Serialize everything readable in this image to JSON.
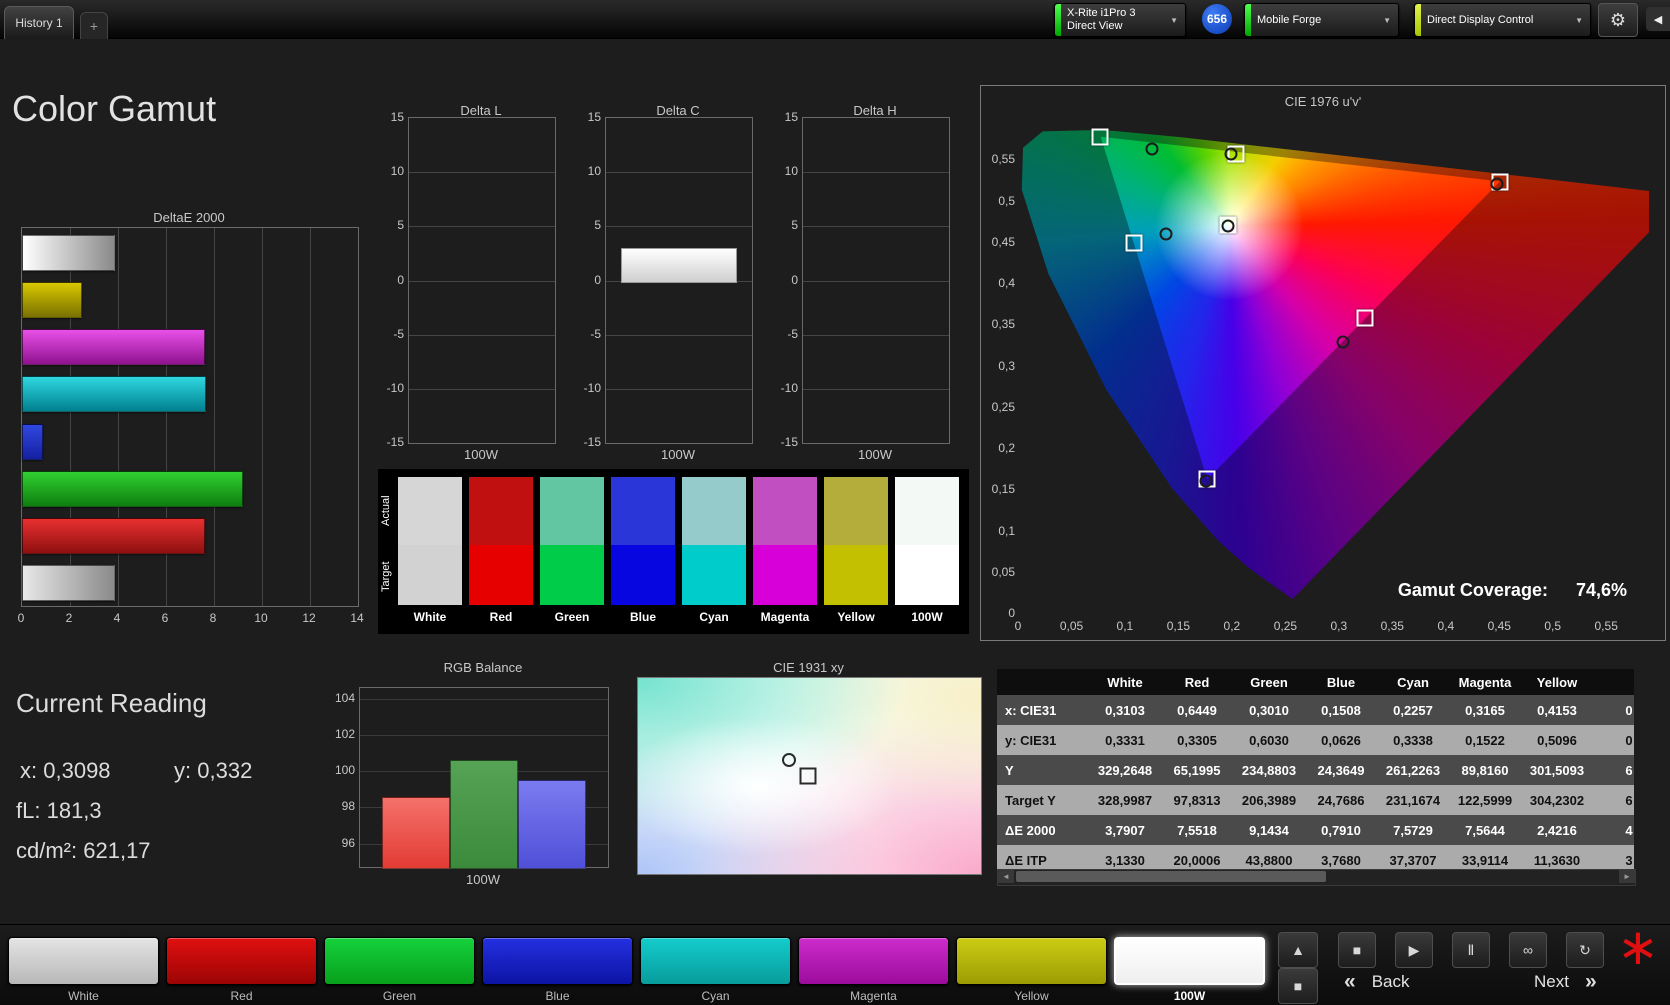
{
  "top_bar": {
    "history_tab": "History 1",
    "add_tab": "+",
    "meter_line1": "X-Rite i1Pro 3",
    "meter_line2": "Direct View",
    "reading_badge": "656",
    "pattern_source": "Mobile Forge",
    "display_control": "Direct Display Control"
  },
  "page_title": "Color Gamut",
  "icons": {
    "chevron_down": "▼",
    "gear": "⚙",
    "collapse_left": "◀",
    "up": "▲",
    "frame": "■",
    "asterisk": "∗",
    "back_chevrons": "«",
    "next_chevrons": "»",
    "scroll_left": "◄",
    "scroll_right": "►"
  },
  "deltae2000": {
    "type": "bar",
    "title": "DeltaE 2000",
    "xlim": [
      0,
      14
    ],
    "xticks": [
      0,
      2,
      4,
      6,
      8,
      10,
      12,
      14
    ],
    "series": [
      {
        "name": "White",
        "value": 3.79,
        "color1": "#ffffff",
        "color2": "#8a8a8a"
      },
      {
        "name": "Yellow",
        "value": 2.42,
        "color1": "#d8c800",
        "color2": "#7a7000"
      },
      {
        "name": "Magenta",
        "value": 7.56,
        "color1": "#e850e8",
        "color2": "#90128f"
      },
      {
        "name": "Cyan",
        "value": 7.57,
        "color1": "#2fd8e0",
        "color2": "#00808f"
      },
      {
        "name": "Blue",
        "value": 0.79,
        "color1": "#3048e0",
        "color2": "#1520a0"
      },
      {
        "name": "Green",
        "value": 9.14,
        "color1": "#30d030",
        "color2": "#0f7f10"
      },
      {
        "name": "Red",
        "value": 7.55,
        "color1": "#e83030",
        "color2": "#8f1010"
      },
      {
        "name": "100W",
        "value": 3.79,
        "color1": "#e8e8e8",
        "color2": "#8a8a8a"
      }
    ]
  },
  "delta_l": {
    "type": "bar",
    "title": "Delta L",
    "ylim": [
      -15,
      15
    ],
    "yticks": [
      15,
      10,
      5,
      0,
      -5,
      -10,
      -15
    ],
    "category": "100W",
    "value": 0
  },
  "delta_c": {
    "type": "bar",
    "title": "Delta C",
    "ylim": [
      -15,
      15
    ],
    "yticks": [
      15,
      10,
      5,
      0,
      -5,
      -10,
      -15
    ],
    "category": "100W",
    "value": 3
  },
  "delta_h": {
    "type": "bar",
    "title": "Delta H",
    "ylim": [
      -15,
      15
    ],
    "yticks": [
      15,
      10,
      5,
      0,
      -5,
      -10,
      -15
    ],
    "category": "100W",
    "value": 0
  },
  "swatches": {
    "row_labels": [
      "Actual",
      "Target"
    ],
    "columns": [
      {
        "label": "White",
        "actual": "#d6d6d6",
        "target": "#d2d2d2"
      },
      {
        "label": "Red",
        "actual": "#c01010",
        "target": "#e60000"
      },
      {
        "label": "Green",
        "actual": "#63c6a2",
        "target": "#00cc4a"
      },
      {
        "label": "Blue",
        "actual": "#2b36d8",
        "target": "#0806e0"
      },
      {
        "label": "Cyan",
        "actual": "#96cbcb",
        "target": "#00cccc"
      },
      {
        "label": "Magenta",
        "actual": "#c24fc2",
        "target": "#d800d8"
      },
      {
        "label": "Yellow",
        "actual": "#b4ad3c",
        "target": "#c2c000"
      },
      {
        "label": "100W",
        "actual": "#f3faf5",
        "target": "#ffffff"
      }
    ]
  },
  "cie1976": {
    "title": "CIE 1976 u'v'",
    "gamut_coverage_label": "Gamut Coverage:",
    "gamut_coverage_value": "74,6%",
    "x_ticks": [
      "0",
      "0,05",
      "0,1",
      "0,15",
      "0,2",
      "0,25",
      "0,3",
      "0,35",
      "0,4",
      "0,45",
      "0,5",
      "0,55"
    ],
    "y_ticks": [
      "0,55",
      "0,5",
      "0,45",
      "0,4",
      "0,35",
      "0,3",
      "0,25",
      "0,2",
      "0,15",
      "0,1",
      "0,05",
      "0"
    ],
    "targets": [
      {
        "name": "green",
        "u": 0.077,
        "v": 0.577
      },
      {
        "name": "yellow",
        "u": 0.204,
        "v": 0.557
      },
      {
        "name": "red",
        "u": 0.451,
        "v": 0.523
      },
      {
        "name": "cyan",
        "u": 0.108,
        "v": 0.448
      },
      {
        "name": "white",
        "u": 0.196,
        "v": 0.47
      },
      {
        "name": "magenta",
        "u": 0.324,
        "v": 0.358
      },
      {
        "name": "blue",
        "u": 0.177,
        "v": 0.162
      }
    ],
    "measurements": [
      {
        "name": "green",
        "u": 0.125,
        "v": 0.563
      },
      {
        "name": "yellow",
        "u": 0.199,
        "v": 0.556
      },
      {
        "name": "red",
        "u": 0.448,
        "v": 0.52
      },
      {
        "name": "cyan",
        "u": 0.138,
        "v": 0.46
      },
      {
        "name": "white",
        "u": 0.196,
        "v": 0.469
      },
      {
        "name": "magenta",
        "u": 0.304,
        "v": 0.328
      },
      {
        "name": "blue",
        "u": 0.176,
        "v": 0.16
      }
    ]
  },
  "current_reading": {
    "title": "Current Reading",
    "items": [
      {
        "label": "x:",
        "value": "0,3098"
      },
      {
        "label": "y:",
        "value": "0,332"
      },
      {
        "label": "fL:",
        "value": "181,3"
      },
      {
        "label": "cd/m²:",
        "value": "621,17"
      }
    ]
  },
  "rgb_balance": {
    "type": "bar",
    "title": "RGB Balance",
    "ylim": [
      94.7,
      104.6
    ],
    "yticks": [
      104,
      102,
      100,
      98,
      96
    ],
    "category": "100W",
    "series": [
      {
        "name": "Red",
        "value": 98.6,
        "color1": "#f4716a",
        "color2": "#e23c35"
      },
      {
        "name": "Green",
        "value": 100.6,
        "color1": "#56a356",
        "color2": "#3c8a3c"
      },
      {
        "name": "Blue",
        "value": 99.5,
        "color1": "#7b7bf0",
        "color2": "#5050d8"
      }
    ]
  },
  "cie1931": {
    "title": "CIE 1931 xy",
    "target_marker": {
      "x_frac": 0.497,
      "y_frac": 0.5
    },
    "measured_marker": {
      "x_frac": 0.44,
      "y_frac": 0.42
    }
  },
  "table": {
    "headers": [
      "",
      "White",
      "Red",
      "Green",
      "Blue",
      "Cyan",
      "Magenta",
      "Yellow"
    ],
    "partial_header": "",
    "rows": [
      {
        "label": "x: CIE31",
        "values": [
          "0,3103",
          "0,6449",
          "0,3010",
          "0,1508",
          "0,2257",
          "0,3165",
          "0,4153"
        ],
        "partial": "0"
      },
      {
        "label": "y: CIE31",
        "values": [
          "0,3331",
          "0,3305",
          "0,6030",
          "0,0626",
          "0,3338",
          "0,1522",
          "0,5096"
        ],
        "partial": "0"
      },
      {
        "label": "Y",
        "values": [
          "329,2648",
          "65,1995",
          "234,8803",
          "24,3649",
          "261,2263",
          "89,8160",
          "301,5093"
        ],
        "partial": "6"
      },
      {
        "label": "Target Y",
        "values": [
          "328,9987",
          "97,8313",
          "206,3989",
          "24,7686",
          "231,1674",
          "122,5999",
          "304,2302"
        ],
        "partial": "6"
      },
      {
        "label": "ΔE 2000",
        "values": [
          "3,7907",
          "7,5518",
          "9,1434",
          "0,7910",
          "7,5729",
          "7,5644",
          "2,4216"
        ],
        "partial": "4"
      },
      {
        "label": "ΔE ITP",
        "values": [
          "3,1330",
          "20,0006",
          "43,8800",
          "3,7680",
          "37,3707",
          "33,9114",
          "11,3630"
        ],
        "partial": "3"
      }
    ]
  },
  "bottom_bar": {
    "patterns": [
      {
        "label": "White",
        "color1": "#e4e4e4",
        "color2": "#b8b8b8",
        "selected": false
      },
      {
        "label": "Red",
        "color1": "#e01010",
        "color2": "#9c0404",
        "selected": false
      },
      {
        "label": "Green",
        "color1": "#14d23c",
        "color2": "#08a01c",
        "selected": false
      },
      {
        "label": "Blue",
        "color1": "#2430e0",
        "color2": "#0c14a4",
        "selected": false
      },
      {
        "label": "Cyan",
        "color1": "#14cccc",
        "color2": "#089c9c",
        "selected": false
      },
      {
        "label": "Magenta",
        "color1": "#cc2ccc",
        "color2": "#9c0c9c",
        "selected": false
      },
      {
        "label": "Yellow",
        "color1": "#cccc14",
        "color2": "#9c9c04",
        "selected": false
      },
      {
        "label": "100W",
        "color1": "#ffffff",
        "color2": "#efefef",
        "selected": true
      }
    ],
    "controls": [
      {
        "name": "stop",
        "glyph": "■"
      },
      {
        "name": "play",
        "glyph": "▶"
      },
      {
        "name": "pause",
        "glyph": "Ⅱ"
      },
      {
        "name": "loop",
        "glyph": "∞"
      },
      {
        "name": "refresh",
        "glyph": "↻"
      }
    ],
    "back_label": "Back",
    "next_label": "Next"
  }
}
